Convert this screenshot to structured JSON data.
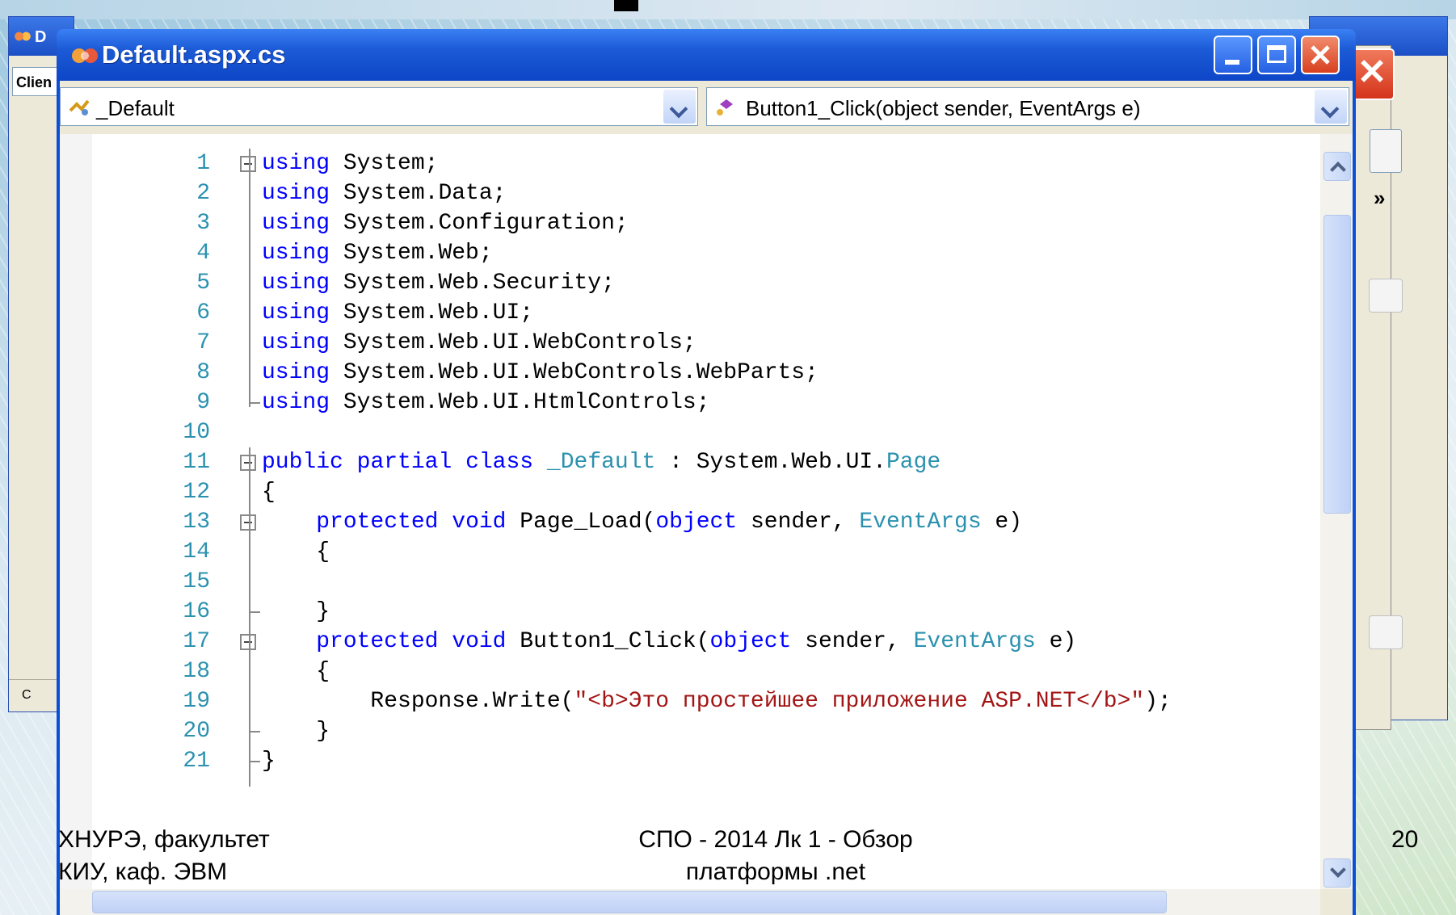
{
  "back_window": {
    "title_fragment": "D",
    "combo_text": "Clien",
    "status_fragment": "C"
  },
  "window": {
    "title": "Default.aspx.cs"
  },
  "nav": {
    "class_dropdown": "_Default",
    "member_dropdown": "Button1_Click(object sender, EventArgs e)"
  },
  "code_lines": [
    {
      "n": "1",
      "t": "using System;"
    },
    {
      "n": "2",
      "t": "using System.Data;"
    },
    {
      "n": "3",
      "t": "using System.Configuration;"
    },
    {
      "n": "4",
      "t": "using System.Web;"
    },
    {
      "n": "5",
      "t": "using System.Web.Security;"
    },
    {
      "n": "6",
      "t": "using System.Web.UI;"
    },
    {
      "n": "7",
      "t": "using System.Web.UI.WebControls;"
    },
    {
      "n": "8",
      "t": "using System.Web.UI.WebControls.WebParts;"
    },
    {
      "n": "9",
      "t": "using System.Web.UI.HtmlControls;"
    },
    {
      "n": "10",
      "t": ""
    },
    {
      "n": "11",
      "t": "public partial class _Default : System.Web.UI.Page"
    },
    {
      "n": "12",
      "t": "{"
    },
    {
      "n": "13",
      "t": "    protected void Page_Load(object sender, EventArgs e)"
    },
    {
      "n": "14",
      "t": "    {"
    },
    {
      "n": "15",
      "t": ""
    },
    {
      "n": "16",
      "t": "    }"
    },
    {
      "n": "17",
      "t": "    protected void Button1_Click(object sender, EventArgs e)"
    },
    {
      "n": "18",
      "t": "    {"
    },
    {
      "n": "19",
      "t": "        Response.Write(\"<b>Это простейшее приложение ASP.NET</b>\");"
    },
    {
      "n": "20",
      "t": "    }"
    },
    {
      "n": "21",
      "t": "}"
    }
  ],
  "colors": {
    "keyword": "#0000ff",
    "type": "#2b91af",
    "string": "#a31515",
    "line_number": "#2b91af"
  },
  "footer": {
    "left_line1": "ХНУРЭ, факультет",
    "left_line2": "КИУ, каф. ЭВМ",
    "center_line1": "СПО - 2014 Лк 1 - Обзор",
    "center_line2": "платформы .net",
    "page_number": "20"
  },
  "icons": {
    "window": "visual-studio-cs-file-icon",
    "class": "class-icon",
    "method": "method-icon"
  }
}
